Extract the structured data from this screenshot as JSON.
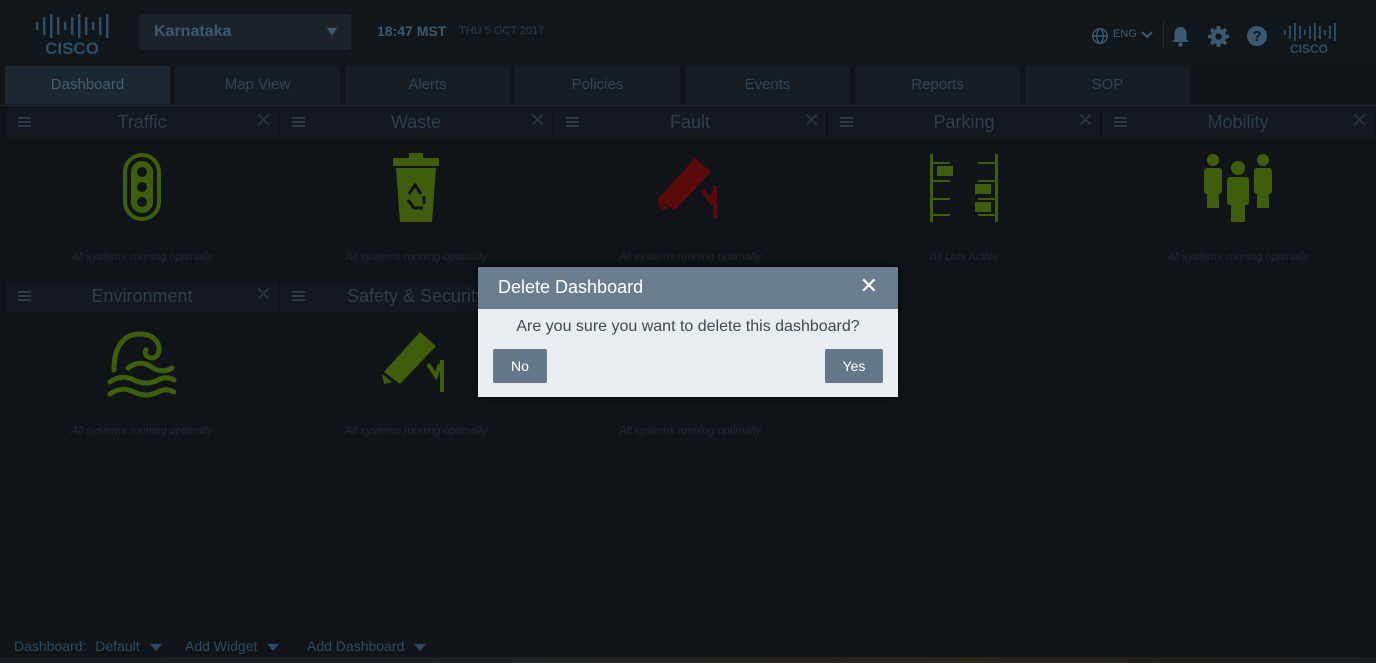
{
  "header": {
    "logo_text": "CISCO",
    "city": "Karnataka",
    "time": "18:47 MST",
    "date": "THU 5 OCT 2017",
    "language": "ENG",
    "icons": [
      "globe-icon",
      "bell-icon",
      "gear-icon",
      "help-icon"
    ]
  },
  "tabs": [
    {
      "label": "Dashboard",
      "active": true
    },
    {
      "label": "Map View"
    },
    {
      "label": "Alerts"
    },
    {
      "label": "Policies"
    },
    {
      "label": "Events"
    },
    {
      "label": "Reports"
    },
    {
      "label": "SOP"
    }
  ],
  "widgets": [
    {
      "title": "Traffic",
      "status": "All systems running optimally",
      "icon": "traffic-light-icon",
      "color": "#3f5e0d"
    },
    {
      "title": "Waste",
      "status": "All systems running optimally",
      "icon": "recycle-bin-icon",
      "color": "#3f5e0d"
    },
    {
      "title": "Fault",
      "status": "All systems running optimally",
      "icon": "camera-fault-icon",
      "color": "#5a0a0a"
    },
    {
      "title": "Parking",
      "status": "All Lots Active",
      "icon": "parking-icon",
      "color": "#3f5e0d"
    },
    {
      "title": "Mobility",
      "status": "All systems running optimally",
      "icon": "people-icon",
      "color": "#3f5e0d"
    },
    {
      "title": "Environment",
      "status": "All systems running optimally",
      "icon": "wave-icon",
      "color": "#3f5e0d"
    },
    {
      "title": "Safety & Security",
      "status": "All systems running optimally",
      "icon": "security-camera-icon",
      "color": "#3f5e0d"
    },
    {
      "status": "All systems running optimally"
    }
  ],
  "bottombar": {
    "dashboard_label": "Dashboard:",
    "dashboard_value": "Default",
    "add_widget": "Add Widget",
    "add_dashboard": "Add Dashboard"
  },
  "modal": {
    "title": "Delete Dashboard",
    "message": "Are you sure you want to delete this dashboard?",
    "no": "No",
    "yes": "Yes",
    "close": "✕"
  }
}
